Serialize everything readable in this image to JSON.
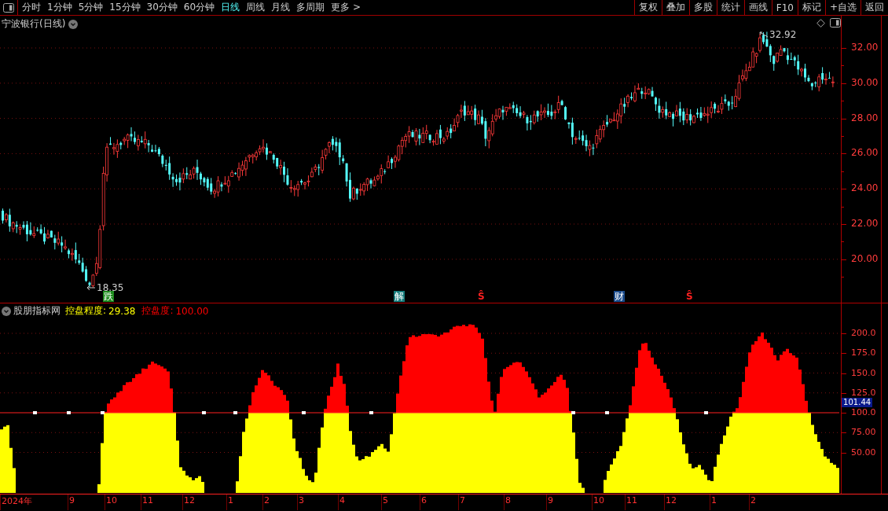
{
  "toolbar": {
    "periods": [
      {
        "label": "分时",
        "selected": false
      },
      {
        "label": "1分钟",
        "selected": false
      },
      {
        "label": "5分钟",
        "selected": false
      },
      {
        "label": "15分钟",
        "selected": false
      },
      {
        "label": "30分钟",
        "selected": false
      },
      {
        "label": "60分钟",
        "selected": false
      },
      {
        "label": "日线",
        "selected": true
      },
      {
        "label": "周线",
        "selected": false
      },
      {
        "label": "月线",
        "selected": false
      },
      {
        "label": "多周期",
        "selected": false
      },
      {
        "label": "更多 >",
        "selected": false
      }
    ],
    "actions": [
      "复权",
      "叠加",
      "多股",
      "统计",
      "画线",
      "F10",
      "标记",
      "+自选",
      "返回"
    ]
  },
  "price_panel": {
    "title": "宁波银行(日线)",
    "high_label": "32.92",
    "low_label": "18.35",
    "y_ticks": [
      "32.00",
      "30.00",
      "28.00",
      "26.00",
      "24.00",
      "22.00",
      "20.00"
    ],
    "event_marks": [
      {
        "label": "跌",
        "kind": "badge",
        "color": "#1e8c1e"
      },
      {
        "label": "解",
        "kind": "badge",
        "color": "#167c7c"
      },
      {
        "label": "Ŝ",
        "kind": "symbol",
        "color": "#ff2020"
      },
      {
        "label": "财",
        "kind": "badge",
        "color": "#1c4c8c"
      },
      {
        "label": "Ŝ",
        "kind": "symbol",
        "color": "#ff2020"
      }
    ]
  },
  "indicator_panel": {
    "source": "股朋指标网",
    "series": [
      {
        "name": "控盘程度:",
        "value": "29.38",
        "color": "#ffff00"
      },
      {
        "name": "控盘度:",
        "value": "100.00",
        "color": "#ff0000"
      }
    ],
    "y_ticks": [
      "200.0",
      "175.0",
      "150.0",
      "125.0",
      "100.0",
      "75.00",
      "50.00"
    ],
    "current_value": "101.44"
  },
  "time_axis": [
    "2024年",
    "9",
    "10",
    "11",
    "12",
    "1",
    "2",
    "3",
    "4",
    "5",
    "6",
    "7",
    "8",
    "9",
    "10",
    "11",
    "12",
    "1",
    "2"
  ]
}
